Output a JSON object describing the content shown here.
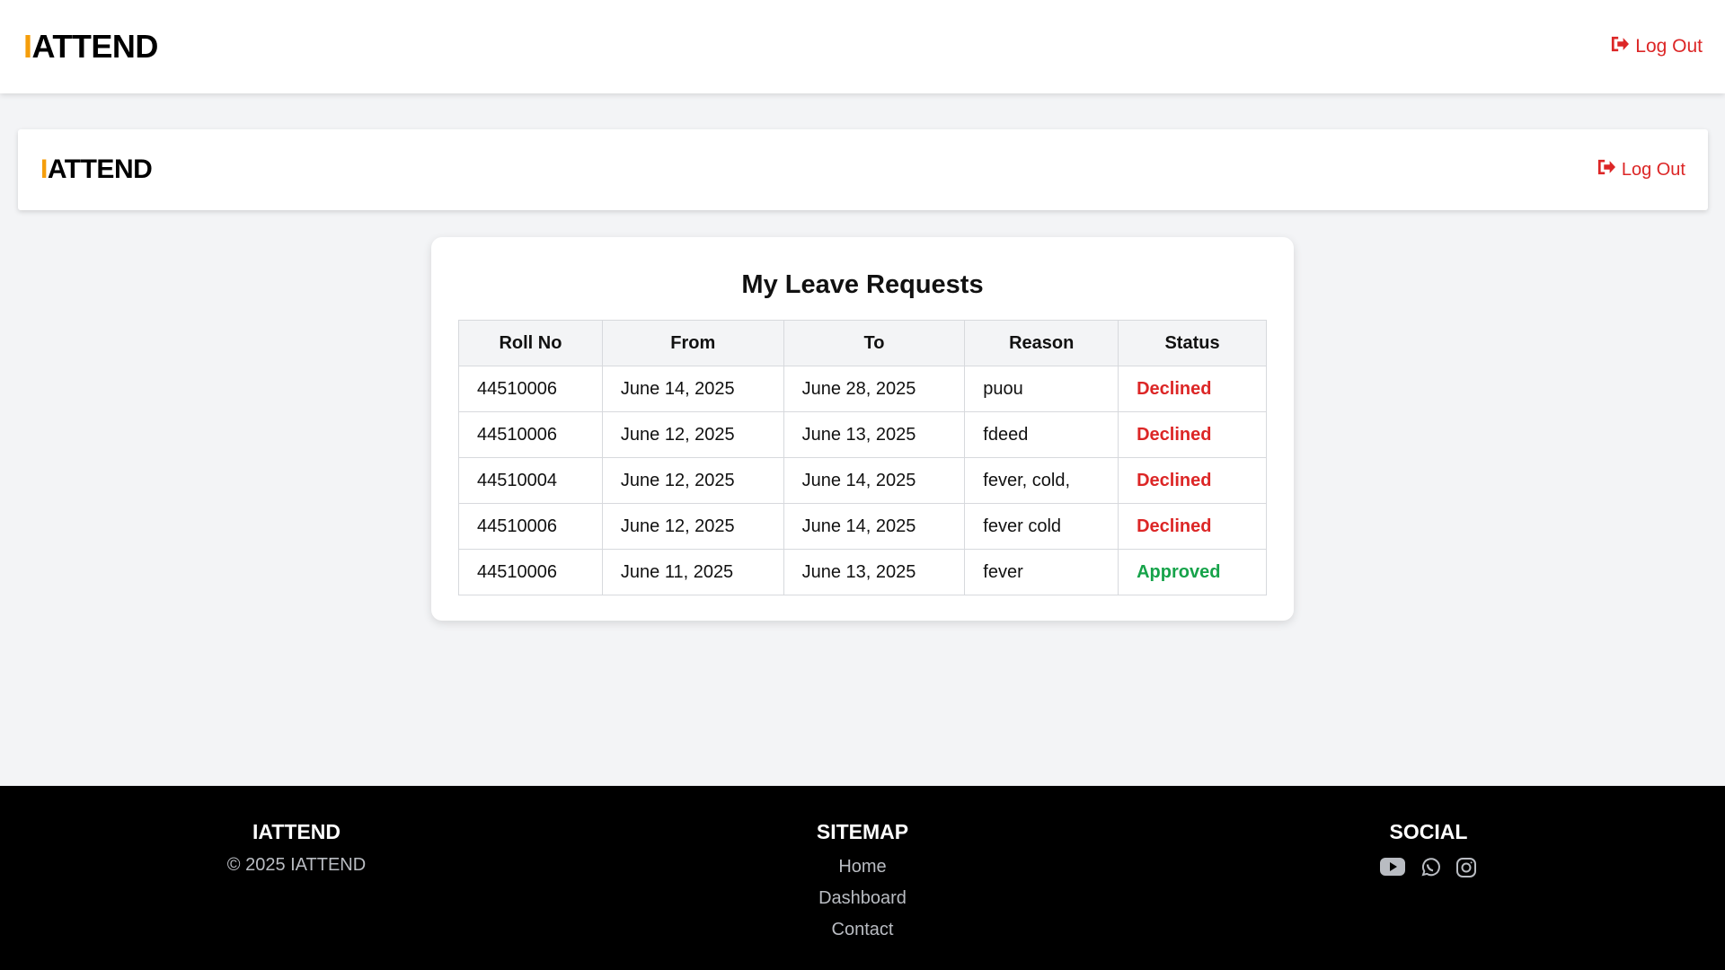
{
  "header": {
    "brand_accent": "I",
    "brand_rest": "ATTEND",
    "logout_label": "Log Out"
  },
  "nav": {
    "brand_accent": "I",
    "brand_rest": "ATTEND",
    "logout_label": "Log Out"
  },
  "main": {
    "title": "My Leave Requests",
    "columns": [
      "Roll No",
      "From",
      "To",
      "Reason",
      "Status"
    ],
    "rows": [
      {
        "roll": "44510006",
        "from": "June 14, 2025",
        "to": "June 28, 2025",
        "reason": "puou",
        "status": "Declined"
      },
      {
        "roll": "44510006",
        "from": "June 12, 2025",
        "to": "June 13, 2025",
        "reason": "fdeed",
        "status": "Declined"
      },
      {
        "roll": "44510004",
        "from": "June 12, 2025",
        "to": "June 14, 2025",
        "reason": "fever, cold,",
        "status": "Declined"
      },
      {
        "roll": "44510006",
        "from": "June 12, 2025",
        "to": "June 14, 2025",
        "reason": "fever cold",
        "status": "Declined"
      },
      {
        "roll": "44510006",
        "from": "June 11, 2025",
        "to": "June 13, 2025",
        "reason": "fever",
        "status": "Approved"
      }
    ]
  },
  "footer": {
    "brand_title": "IATTEND",
    "copyright": "© 2025 IATTEND",
    "sitemap_title": "SITEMAP",
    "sitemap_links": [
      "Home",
      "Dashboard",
      "Contact"
    ],
    "social_title": "SOCIAL",
    "social_icons": [
      "youtube-icon",
      "whatsapp-icon",
      "instagram-icon"
    ]
  },
  "colors": {
    "accent": "#f59e0b",
    "logout": "#dc2626",
    "declined": "#dc2626",
    "approved": "#16a34a",
    "footer_bg": "#000000"
  }
}
